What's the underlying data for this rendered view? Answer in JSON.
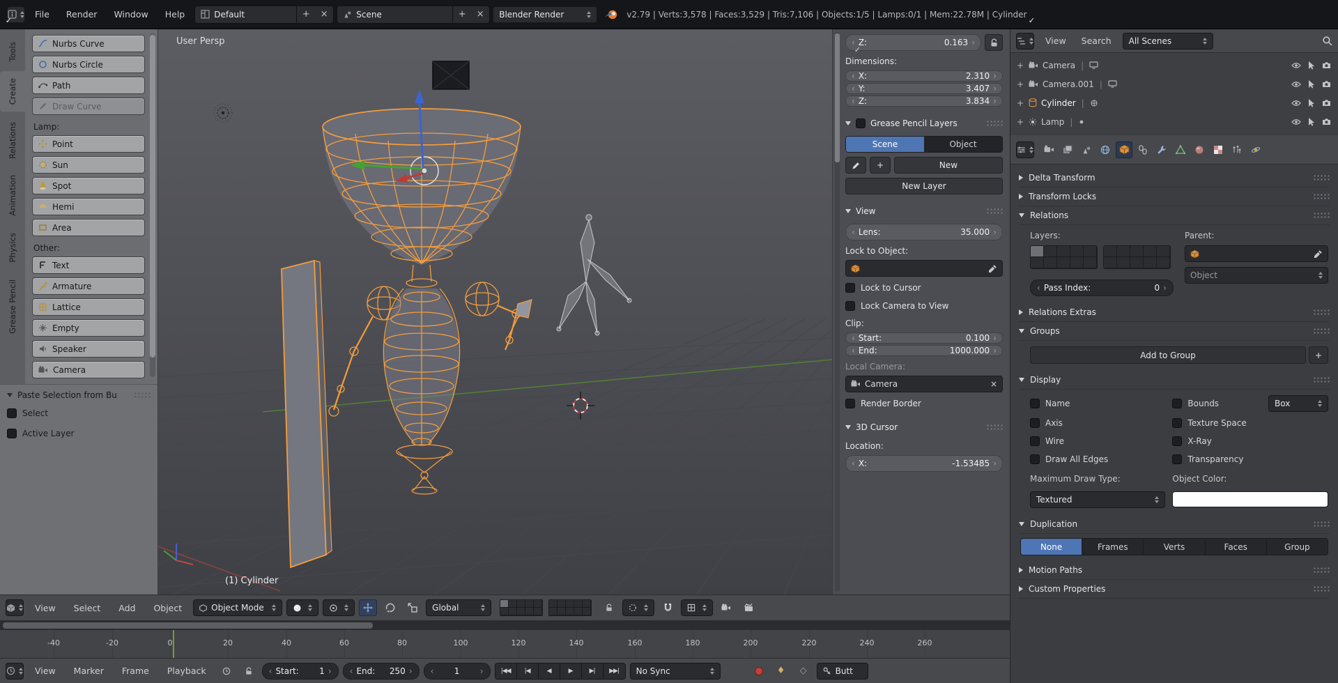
{
  "header": {
    "menus": [
      "File",
      "Render",
      "Window",
      "Help"
    ],
    "layout_value": "Default",
    "scene_value": "Scene",
    "engine_value": "Blender Render",
    "stats": "v2.79 | Verts:3,578 | Faces:3,529 | Tris:7,106 | Objects:1/5 | Lamps:0/1 | Mem:22.78M | Cylinder"
  },
  "toolshelf": {
    "tabs": [
      "Tools",
      "Create",
      "Relations",
      "Animation",
      "Physics",
      "Grease Pencil"
    ],
    "active_tab": "Create",
    "curve_buttons": [
      "Nurbs Curve",
      "Nurbs Circle",
      "Path",
      "Draw Curve"
    ],
    "lamp_label": "Lamp:",
    "lamp_buttons": [
      "Point",
      "Sun",
      "Spot",
      "Hemi",
      "Area"
    ],
    "other_label": "Other:",
    "other_buttons": [
      "Text",
      "Armature",
      "Lattice",
      "Empty",
      "Speaker",
      "Camera"
    ],
    "paste_panel": {
      "title": "Paste Selection from Bu",
      "options": [
        {
          "label": "Select",
          "checked": true
        },
        {
          "label": "Active Layer",
          "checked": true
        }
      ]
    }
  },
  "viewport": {
    "view_label": "User Persp",
    "object_label": "(1) Cylinder"
  },
  "npanel": {
    "z": {
      "label": "Z:",
      "value": "0.163"
    },
    "dimensions_label": "Dimensions:",
    "dims": [
      {
        "label": "X:",
        "value": "2.310"
      },
      {
        "label": "Y:",
        "value": "3.407"
      },
      {
        "label": "Z:",
        "value": "3.834"
      }
    ],
    "grease_pencil_panel": "Grease Pencil Layers",
    "gp_tabs": [
      "Scene",
      "Object"
    ],
    "gp_active_tab": "Scene",
    "new_button": "New",
    "new_layer_button": "New Layer",
    "view_panel": "View",
    "lens": {
      "label": "Lens:",
      "value": "35.000"
    },
    "lock_to_object_label": "Lock to Object:",
    "lock_to_cursor": {
      "label": "Lock to Cursor",
      "checked": false
    },
    "lock_camera_to_view": {
      "label": "Lock Camera to View",
      "checked": false
    },
    "clip_label": "Clip:",
    "clip_start": {
      "label": "Start:",
      "value": "0.100"
    },
    "clip_end": {
      "label": "End:",
      "value": "1000.000"
    },
    "local_camera_label": "Local Camera:",
    "local_camera_value": "Camera",
    "render_border": {
      "label": "Render Border",
      "checked": false
    },
    "cursor_panel": "3D Cursor",
    "location_label": "Location:",
    "cursor_x": {
      "label": "X:",
      "value": "-1.53485"
    }
  },
  "outliner": {
    "menus": [
      "View",
      "Search"
    ],
    "scope": "All Scenes",
    "items": [
      {
        "name": "Camera",
        "type": "camera"
      },
      {
        "name": "Camera.001",
        "type": "camera"
      },
      {
        "name": "Cylinder",
        "type": "mesh"
      },
      {
        "name": "Lamp",
        "type": "lamp"
      }
    ]
  },
  "properties": {
    "panels": {
      "delta_transform": "Delta Transform",
      "transform_locks": "Transform Locks",
      "relations": "Relations",
      "relations_extras": "Relations Extras",
      "groups": "Groups",
      "display": "Display",
      "duplication": "Duplication",
      "motion_paths": "Motion Paths",
      "custom_properties": "Custom Properties"
    },
    "relations": {
      "layers_label": "Layers:",
      "parent_label": "Parent:",
      "parent_type_value": "Object",
      "pass_index": {
        "label": "Pass Index:",
        "value": "0"
      }
    },
    "groups": {
      "add_button": "Add to Group"
    },
    "display": {
      "checks_left": [
        {
          "label": "Name",
          "checked": false
        },
        {
          "label": "Axis",
          "checked": false
        },
        {
          "label": "Wire",
          "checked": true
        },
        {
          "label": "Draw All Edges",
          "checked": true
        }
      ],
      "checks_right": [
        {
          "label": "Bounds",
          "checked": false
        },
        {
          "label": "Texture Space",
          "checked": false
        },
        {
          "label": "X-Ray",
          "checked": false
        },
        {
          "label": "Transparency",
          "checked": false
        }
      ],
      "bounds_type": "Box",
      "max_draw_label": "Maximum Draw Type:",
      "max_draw_value": "Textured",
      "object_color_label": "Object Color:",
      "object_color": "#ffffff"
    },
    "duplication": {
      "options": [
        "None",
        "Frames",
        "Verts",
        "Faces",
        "Group"
      ],
      "selected": "None"
    }
  },
  "viewport_header": {
    "menus": [
      "View",
      "Select",
      "Add",
      "Object"
    ],
    "mode": "Object Mode",
    "orientation": "Global"
  },
  "timeline": {
    "ticks": [
      "-40",
      "-20",
      "0",
      "20",
      "40",
      "60",
      "80",
      "100",
      "120",
      "140",
      "160",
      "180",
      "200",
      "220",
      "240",
      "260"
    ],
    "current_frame": "1"
  },
  "timeline_header": {
    "menus": [
      "View",
      "Marker",
      "Frame",
      "Playback"
    ],
    "start": {
      "label": "Start:",
      "value": "1"
    },
    "end": {
      "label": "End:",
      "value": "250"
    },
    "frame_value": "1",
    "sync": "No Sync",
    "keying_set": "Butt"
  }
}
